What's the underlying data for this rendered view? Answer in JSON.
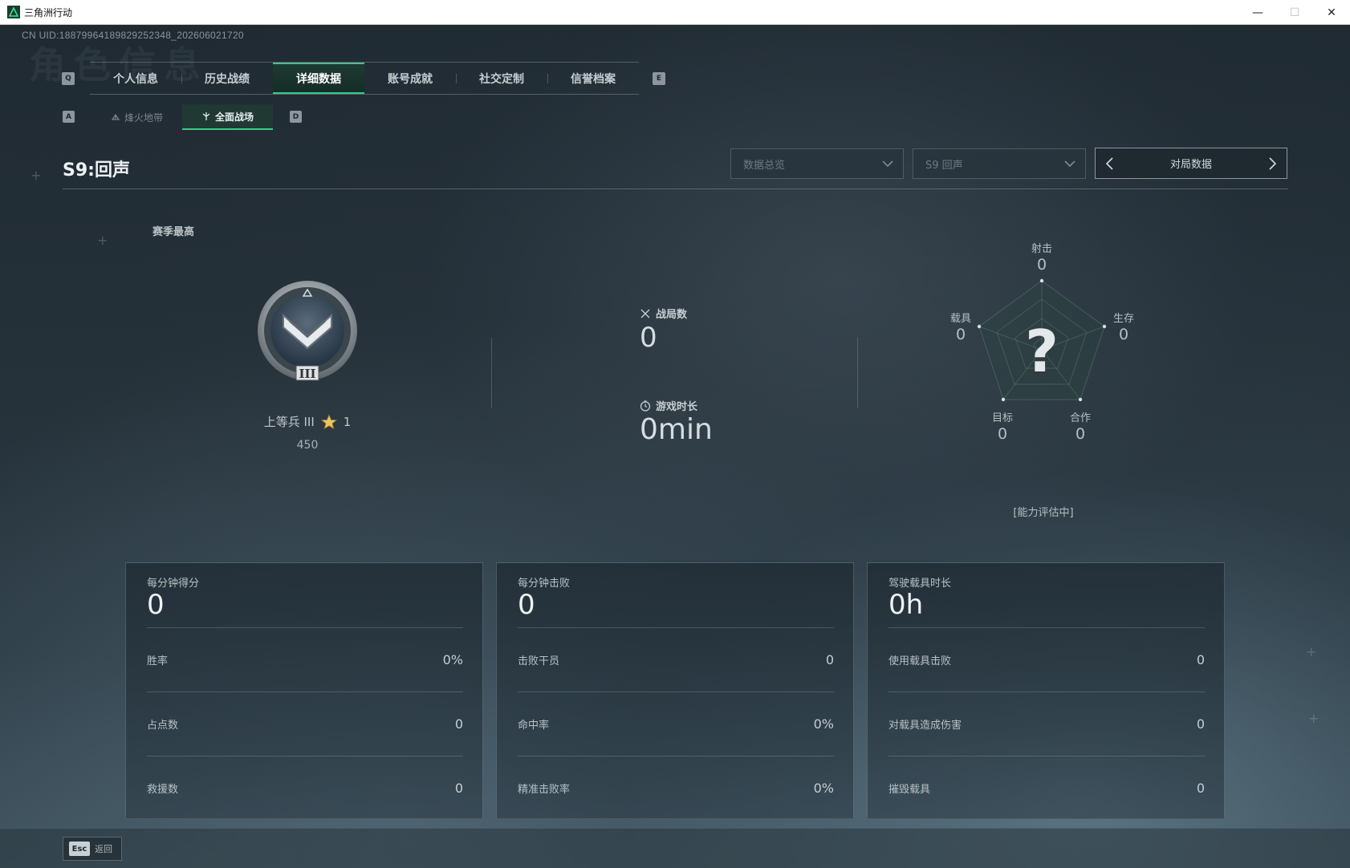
{
  "window": {
    "title": "三角洲行动",
    "controls": {
      "minimize": "—",
      "maximize": "☐",
      "close": "✕"
    }
  },
  "uid_text": "CN UID:188799641898292523​48_202606021720",
  "ghost_title": "角色信息",
  "key_hints": {
    "prev_tab": "Q",
    "next_tab": "E",
    "prev_sub": "A",
    "next_sub": "D"
  },
  "tabs": [
    {
      "label": "个人信息",
      "active": false
    },
    {
      "label": "历史战绩",
      "active": false
    },
    {
      "label": "详细数据",
      "active": true
    },
    {
      "label": "账号成就",
      "active": false
    },
    {
      "label": "社交定制",
      "active": false
    },
    {
      "label": "信誉档案",
      "active": false
    }
  ],
  "subtabs": [
    {
      "label": "烽火地带",
      "icon": "extraction-icon",
      "active": false
    },
    {
      "label": "全面战场",
      "icon": "battlefield-icon",
      "active": true
    }
  ],
  "season_title": "S9:回声",
  "filters": {
    "view_dropdown": "数据总览",
    "season_dropdown": "S9 回声",
    "pager_label": "对局数据"
  },
  "rank": {
    "section_label": "赛季最高",
    "name": "上等兵 III",
    "stars": "1",
    "score": "450",
    "badge_tier": "III"
  },
  "center_stats": {
    "matches_label": "战局数",
    "matches_value": "0",
    "playtime_label": "游戏时长",
    "playtime_value": "0min"
  },
  "radar": {
    "axes": [
      {
        "label": "射击",
        "value": "0"
      },
      {
        "label": "生存",
        "value": "0"
      },
      {
        "label": "合作",
        "value": "0"
      },
      {
        "label": "目标",
        "value": "0"
      },
      {
        "label": "载具",
        "value": "0"
      }
    ],
    "placeholder": "?",
    "note": "[能力评估中]"
  },
  "cards": [
    {
      "label": "每分钟得分",
      "value": "0",
      "rows": [
        {
          "label": "胜率",
          "value": "0%"
        },
        {
          "label": "占点数",
          "value": "0"
        },
        {
          "label": "救援数",
          "value": "0"
        }
      ]
    },
    {
      "label": "每分钟击败",
      "value": "0",
      "rows": [
        {
          "label": "击败干员",
          "value": "0"
        },
        {
          "label": "命中率",
          "value": "0%"
        },
        {
          "label": "精准击败率",
          "value": "0%"
        }
      ]
    },
    {
      "label": "驾驶载具时长",
      "value": "0h",
      "rows": [
        {
          "label": "使用载具击败",
          "value": "0"
        },
        {
          "label": "对载具造成伤害",
          "value": "0"
        },
        {
          "label": "摧毁载具",
          "value": "0"
        }
      ]
    }
  ],
  "footer": {
    "esc_key": "Esc",
    "esc_label": "返回"
  },
  "colors": {
    "accent": "#2fd08a",
    "background": "#1f2a32",
    "text": "#c9d0d4"
  }
}
